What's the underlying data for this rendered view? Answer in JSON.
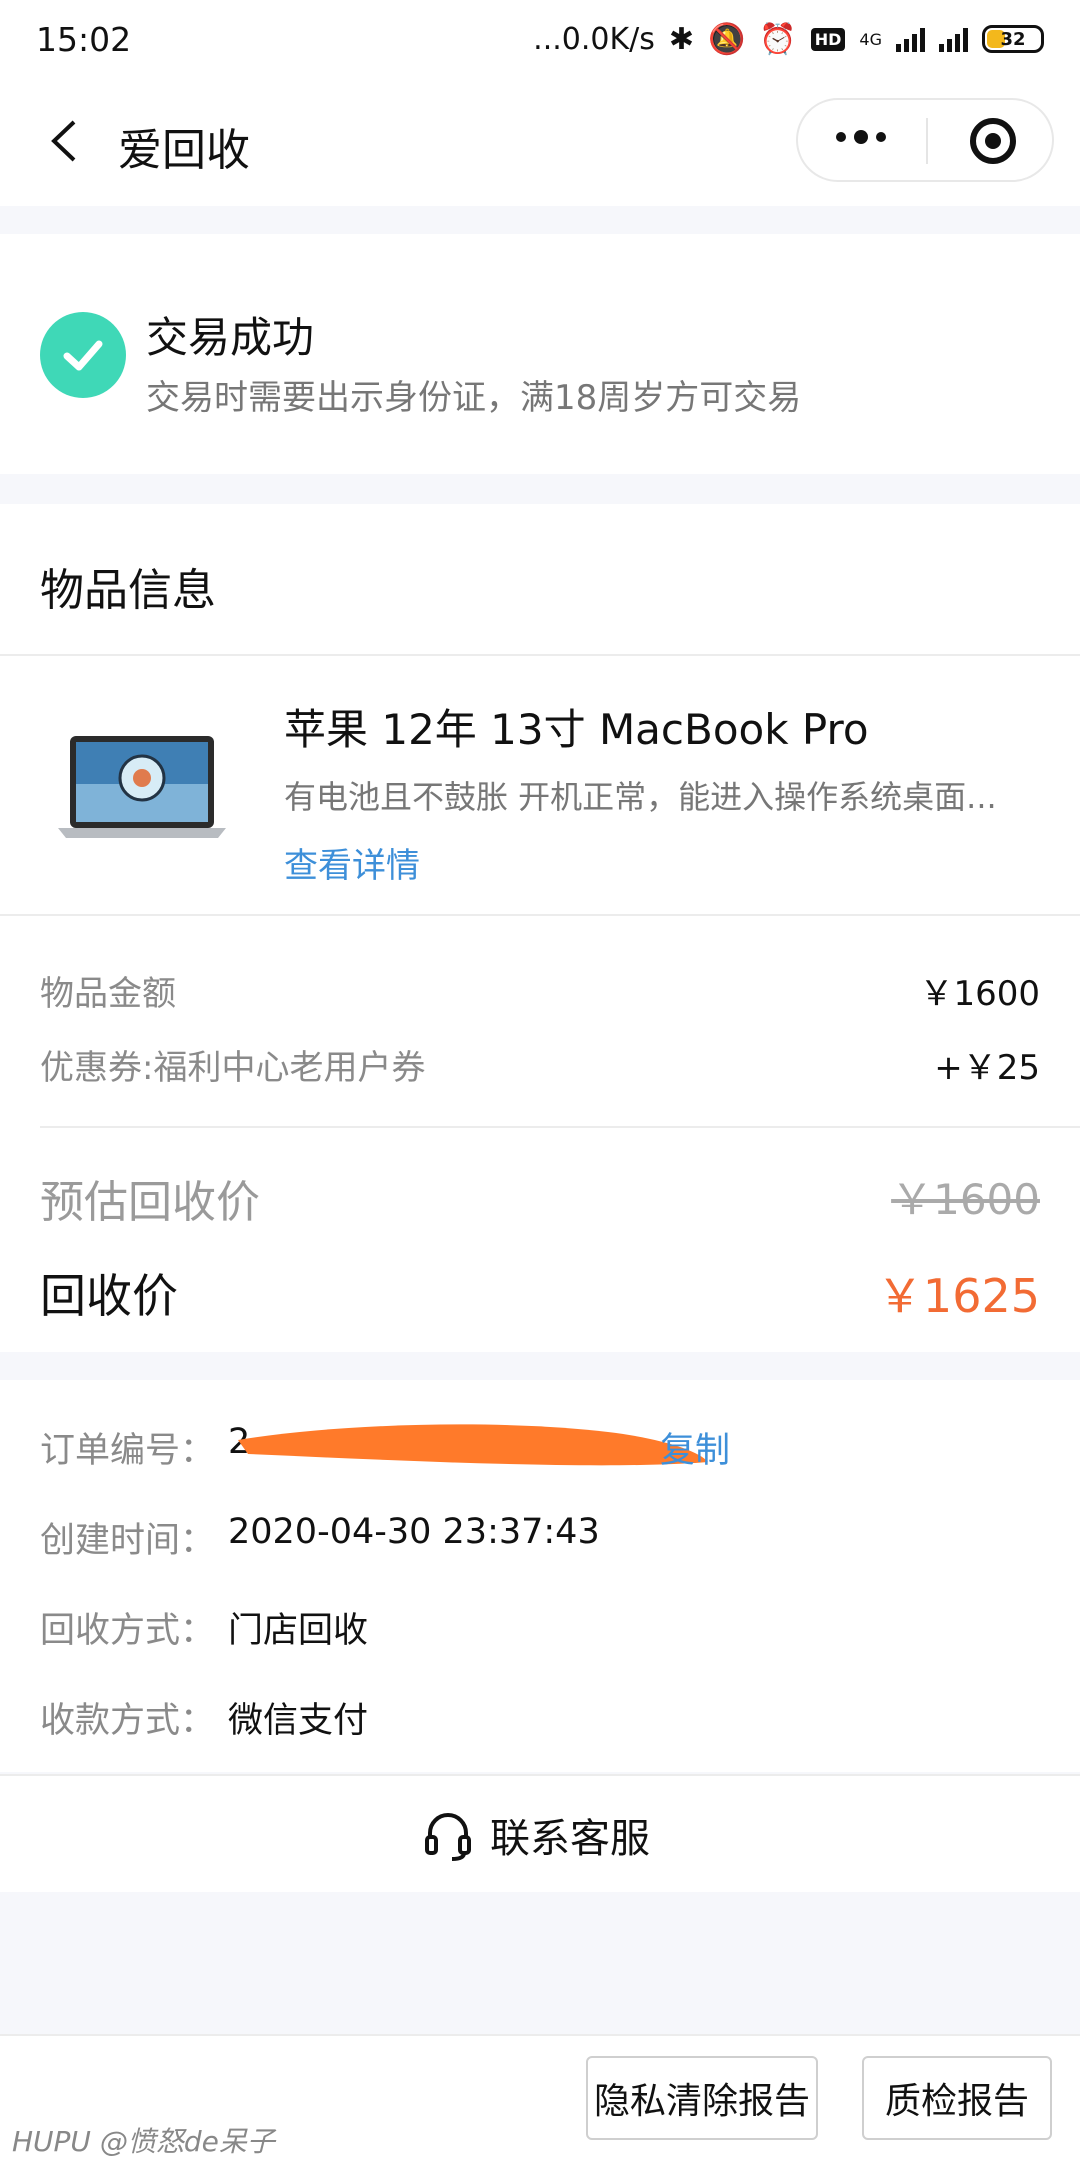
{
  "status_bar": {
    "time": "15:02",
    "speed": "...0.0K/s",
    "network": "4G",
    "battery": "32"
  },
  "nav": {
    "title": "爱回收"
  },
  "success": {
    "title": "交易成功",
    "subtitle": "交易时需要出示身份证，满18周岁方可交易",
    "accent": "#3fd8b7"
  },
  "item": {
    "section_title": "物品信息",
    "name": "苹果 12年 13寸 MacBook Pro",
    "desc": "有电池且不鼓胀 开机正常，能进入操作系统桌面...",
    "detail_link": "查看详情",
    "amount_label": "物品金额",
    "amount_value": "￥1600",
    "coupon_label": "优惠券:福利中心老用户券",
    "coupon_value": "+￥25",
    "estimate_label": "预估回收价",
    "estimate_value": "￥1600",
    "final_label": "回收价",
    "final_value": "￥1625",
    "price_color": "#f26b34"
  },
  "order": {
    "number_label": "订单编号：",
    "number_value": "2",
    "copy_label": "复制",
    "created_label": "创建时间：",
    "created_value": "2020-04-30 23:37:43",
    "method_label": "回收方式：",
    "method_value": "门店回收",
    "payment_label": "收款方式：",
    "payment_value": "微信支付"
  },
  "contact": {
    "label": "联系客服"
  },
  "bottom": {
    "privacy_button": "隐私清除报告",
    "quality_button": "质检报告"
  },
  "watermark": "HUPU @愤怒de呆子"
}
